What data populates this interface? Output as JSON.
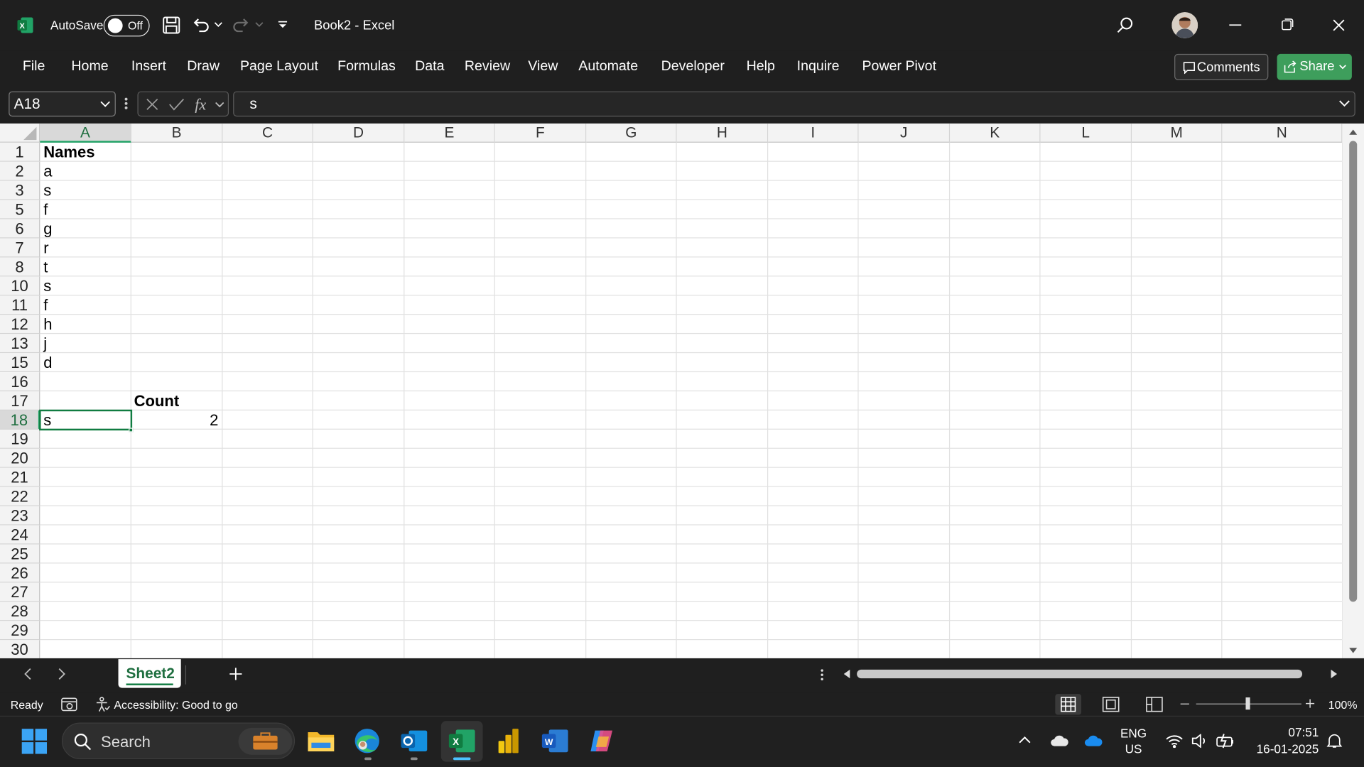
{
  "titlebar": {
    "autosave_label": "AutoSave",
    "autosave_state": "Off",
    "doc_title": "Book2  -  Excel"
  },
  "menu": {
    "items": [
      "File",
      "Home",
      "Insert",
      "Draw",
      "Page Layout",
      "Formulas",
      "Data",
      "Review",
      "View",
      "Automate",
      "Developer",
      "Help",
      "Inquire",
      "Power Pivot"
    ],
    "comments_label": "Comments",
    "share_label": "Share"
  },
  "formula_bar": {
    "name_box": "A18",
    "formula": "s"
  },
  "grid": {
    "columns": [
      "A",
      "B",
      "C",
      "D",
      "E",
      "F",
      "G",
      "H",
      "I",
      "J",
      "K",
      "L",
      "M",
      "N"
    ],
    "rows": [
      "1",
      "2",
      "3",
      "5",
      "6",
      "7",
      "8",
      "10",
      "11",
      "12",
      "13",
      "15",
      "16",
      "17",
      "18",
      "19",
      "20",
      "21",
      "22",
      "23",
      "24",
      "25",
      "26",
      "27",
      "28",
      "29",
      "30"
    ],
    "selected_column": "A",
    "selected_row": "18",
    "cells": {
      "A1": "Names",
      "A2": "a",
      "A3": "s",
      "A5": "f",
      "A6": "g",
      "A7": "r",
      "A8": "t",
      "A10": "s",
      "A11": "f",
      "A12": "h",
      "A13": "j",
      "A15": "d",
      "B17": "Count",
      "A18": "s",
      "B18": "2"
    }
  },
  "sheets": {
    "tabs": [
      "Sheet2"
    ],
    "active": "Sheet2"
  },
  "status": {
    "ready": "Ready",
    "accessibility": "Accessibility: Good to go",
    "zoom": "100%"
  },
  "taskbar": {
    "search_placeholder": "Search",
    "lang_line1": "ENG",
    "lang_line2": "US",
    "time": "07:51",
    "date": "16-01-2025"
  },
  "colors": {
    "excel_green": "#107c41",
    "share_green": "#3e9e5c",
    "dark_bg": "#1f1f1f"
  }
}
